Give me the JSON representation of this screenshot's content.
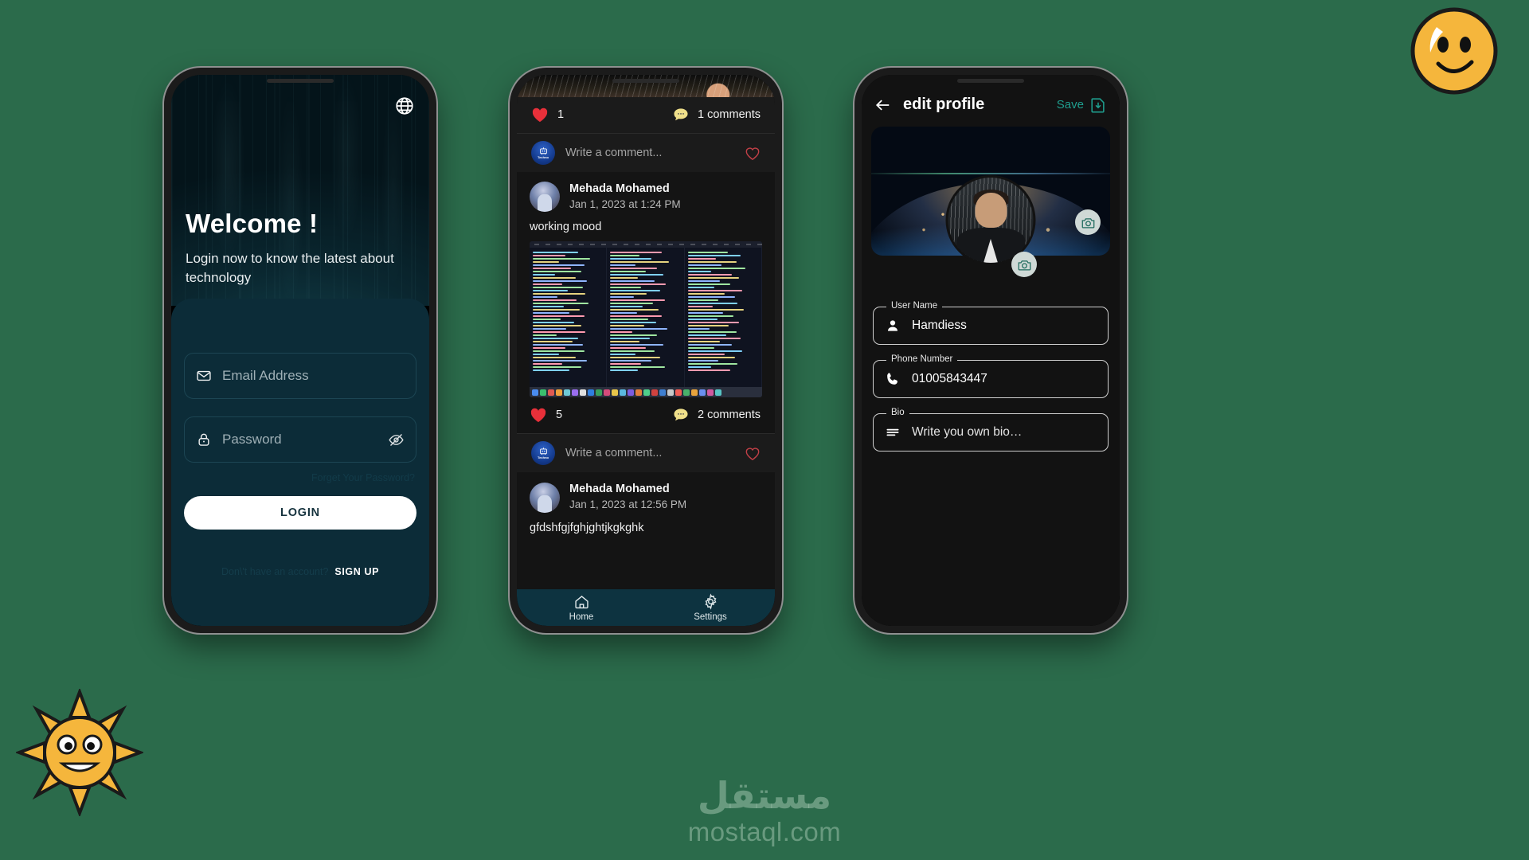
{
  "background_color": "#2b6b4b",
  "watermark": {
    "arabic": "مستقل",
    "latin": "mostaql.com"
  },
  "stickers": {
    "smiley": "smiley-face-sticker",
    "sun": "sun-face-sticker"
  },
  "phone1": {
    "name": "login-screen",
    "hero": {
      "globe_icon": "globe-icon",
      "title": "Welcome !",
      "subtitle": "Login now to know the latest about technology"
    },
    "form": {
      "email": {
        "icon": "envelope-icon",
        "placeholder": "Email Address",
        "value": ""
      },
      "password": {
        "icon": "lock-icon",
        "placeholder": "Password",
        "value": "",
        "toggle_icon": "eye-off-icon"
      },
      "forgot_label": "Forget Your Password?",
      "login_label": "LOGIN",
      "signup_question": "Don\\'t have an account?",
      "signup_label": "SIGN UP"
    }
  },
  "phone2": {
    "name": "feed-screen",
    "post_top": {
      "likes": "1",
      "like_icon": "heart-filled-icon",
      "comments": "1 comments",
      "comment_icon": "speech-bubble-icon",
      "comment_box": {
        "avatar": "techno-logo-avatar",
        "avatar_label": "Techno",
        "placeholder": "Write a comment...",
        "like_icon": "heart-outline-icon"
      }
    },
    "post_main": {
      "avatar": "user-avatar",
      "author": "Mehada Mohamed",
      "date": "Jan 1, 2023 at 1:24 PM",
      "text": "working mood",
      "image": "code-editor-screenshot",
      "likes": "5",
      "like_icon": "heart-filled-icon",
      "comments": "2 comments",
      "comment_icon": "speech-bubble-icon",
      "comment_box": {
        "avatar": "techno-logo-avatar",
        "avatar_label": "Techno",
        "placeholder": "Write a comment...",
        "like_icon": "heart-outline-icon"
      }
    },
    "post_bottom": {
      "avatar": "user-avatar",
      "author": "Mehada Mohamed",
      "date": "Jan 1, 2023 at 12:56 PM",
      "text": "gfdshfgjfghjghtjkgkghk"
    },
    "nav": [
      {
        "icon": "home-icon",
        "label": "Home"
      },
      {
        "icon": "gear-icon",
        "label": "Settings"
      }
    ]
  },
  "phone3": {
    "name": "edit-profile-screen",
    "header": {
      "back_icon": "back-arrow-icon",
      "title": "edit profile",
      "save_label": "Save",
      "save_icon": "save-download-icon",
      "save_color": "#1f9e8e"
    },
    "cover": {
      "image": "earth-from-space-cover",
      "camera_icon": "camera-icon"
    },
    "avatar": {
      "image": "profile-photo",
      "camera_icon": "camera-icon"
    },
    "fields": [
      {
        "label": "User Name",
        "icon": "person-icon",
        "value": "Hamdiess",
        "is_placeholder": false
      },
      {
        "label": "Phone Number",
        "icon": "phone-icon",
        "value": "01005843447",
        "is_placeholder": false
      },
      {
        "label": "Bio",
        "icon": "lines-icon",
        "value": "Write you own bio…",
        "is_placeholder": true
      }
    ]
  }
}
